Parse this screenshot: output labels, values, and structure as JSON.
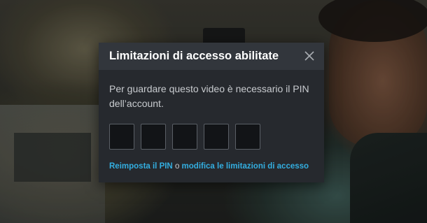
{
  "dialog": {
    "title": "Limitazioni di accesso abilitate",
    "close_icon": "close-icon",
    "message": "Per guardare questo video è necessario il PIN dell’account.",
    "pin_digits": [
      "",
      "",
      "",
      "",
      ""
    ],
    "reset_link": "Reimposta il PIN",
    "connector": " o ",
    "modify_link": "modifica le limitazioni di accesso"
  },
  "colors": {
    "dialog_bg": "#26292e",
    "header_bg": "#32363c",
    "link": "#33aee0",
    "text": "#c8cbcf"
  }
}
